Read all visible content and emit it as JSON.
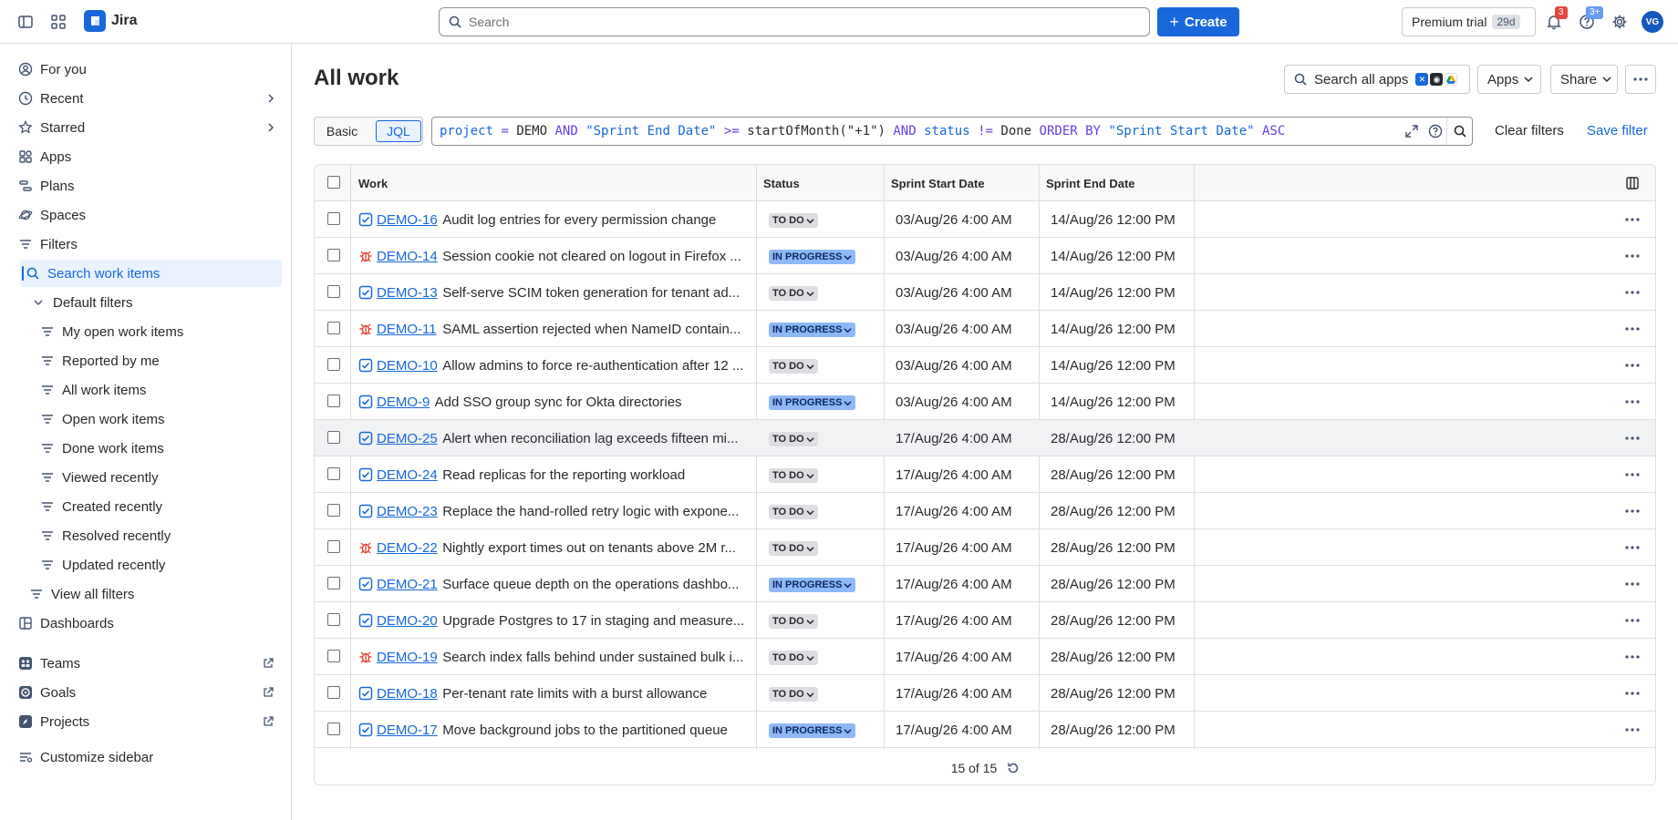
{
  "topbar": {
    "brand": "Jira",
    "search_placeholder": "Search",
    "create_label": "Create",
    "trial_label": "Premium trial",
    "trial_days": "29d",
    "notifications_badge": "3",
    "help_badge": "3+",
    "avatar_initials": "VG"
  },
  "sidebar": {
    "for_you": "For you",
    "recent": "Recent",
    "starred": "Starred",
    "apps": "Apps",
    "plans": "Plans",
    "spaces": "Spaces",
    "filters": "Filters",
    "search_work_items": "Search work items",
    "default_filters": "Default filters",
    "default_filter_items": [
      "My open work items",
      "Reported by me",
      "All work items",
      "Open work items",
      "Done work items",
      "Viewed recently",
      "Created recently",
      "Resolved recently",
      "Updated recently"
    ],
    "view_all_filters": "View all filters",
    "dashboards": "Dashboards",
    "teams": "Teams",
    "goals": "Goals",
    "projects": "Projects",
    "customize": "Customize sidebar"
  },
  "main": {
    "title": "All work",
    "search_all_apps": "Search all apps",
    "apps_button": "Apps",
    "share_button": "Share",
    "mode_basic": "Basic",
    "mode_jql": "JQL",
    "jql": {
      "t1": "project",
      "t2": " = ",
      "t3": "DEMO",
      "t4": " AND ",
      "t5": "\"Sprint End Date\"",
      "t6": " >= ",
      "t7": "startOfMonth(",
      "t8": "\"+1\"",
      "t9": ")",
      "t10": " AND ",
      "t11": "status",
      "t12": " != ",
      "t13": "Done",
      "t14": " ORDER BY ",
      "t15": "\"Sprint Start Date\"",
      "t16": " ASC"
    },
    "clear_filters": "Clear filters",
    "save_filter": "Save filter",
    "columns": {
      "work": "Work",
      "status": "Status",
      "sprint_start": "Sprint Start Date",
      "sprint_end": "Sprint End Date"
    },
    "rows": [
      {
        "type": "task",
        "key": "DEMO-16",
        "summary": "Audit log entries for every permission change",
        "status": "TO DO",
        "start": "03/Aug/26 4:00 AM",
        "end": "14/Aug/26 12:00 PM"
      },
      {
        "type": "bug",
        "key": "DEMO-14",
        "summary": "Session cookie not cleared on logout in Firefox ...",
        "status": "IN PROGRESS",
        "start": "03/Aug/26 4:00 AM",
        "end": "14/Aug/26 12:00 PM"
      },
      {
        "type": "task",
        "key": "DEMO-13",
        "summary": "Self-serve SCIM token generation for tenant ad...",
        "status": "TO DO",
        "start": "03/Aug/26 4:00 AM",
        "end": "14/Aug/26 12:00 PM"
      },
      {
        "type": "bug",
        "key": "DEMO-11",
        "summary": "SAML assertion rejected when NameID contain...",
        "status": "IN PROGRESS",
        "start": "03/Aug/26 4:00 AM",
        "end": "14/Aug/26 12:00 PM"
      },
      {
        "type": "task",
        "key": "DEMO-10",
        "summary": "Allow admins to force re-authentication after 12 ...",
        "status": "TO DO",
        "start": "03/Aug/26 4:00 AM",
        "end": "14/Aug/26 12:00 PM"
      },
      {
        "type": "task",
        "key": "DEMO-9",
        "summary": "Add SSO group sync for Okta directories",
        "status": "IN PROGRESS",
        "start": "03/Aug/26 4:00 AM",
        "end": "14/Aug/26 12:00 PM"
      },
      {
        "type": "task",
        "key": "DEMO-25",
        "summary": "Alert when reconciliation lag exceeds fifteen mi...",
        "status": "TO DO",
        "start": "17/Aug/26 4:00 AM",
        "end": "28/Aug/26 12:00 PM"
      },
      {
        "type": "task",
        "key": "DEMO-24",
        "summary": "Read replicas for the reporting workload",
        "status": "TO DO",
        "start": "17/Aug/26 4:00 AM",
        "end": "28/Aug/26 12:00 PM"
      },
      {
        "type": "task",
        "key": "DEMO-23",
        "summary": "Replace the hand-rolled retry logic with expone...",
        "status": "TO DO",
        "start": "17/Aug/26 4:00 AM",
        "end": "28/Aug/26 12:00 PM"
      },
      {
        "type": "bug",
        "key": "DEMO-22",
        "summary": "Nightly export times out on tenants above 2M r...",
        "status": "TO DO",
        "start": "17/Aug/26 4:00 AM",
        "end": "28/Aug/26 12:00 PM"
      },
      {
        "type": "task",
        "key": "DEMO-21",
        "summary": "Surface queue depth on the operations dashbo...",
        "status": "IN PROGRESS",
        "start": "17/Aug/26 4:00 AM",
        "end": "28/Aug/26 12:00 PM"
      },
      {
        "type": "task",
        "key": "DEMO-20",
        "summary": "Upgrade Postgres to 17 in staging and measure...",
        "status": "TO DO",
        "start": "17/Aug/26 4:00 AM",
        "end": "28/Aug/26 12:00 PM"
      },
      {
        "type": "bug",
        "key": "DEMO-19",
        "summary": "Search index falls behind under sustained bulk i...",
        "status": "TO DO",
        "start": "17/Aug/26 4:00 AM",
        "end": "28/Aug/26 12:00 PM"
      },
      {
        "type": "task",
        "key": "DEMO-18",
        "summary": "Per-tenant rate limits with a burst allowance",
        "status": "TO DO",
        "start": "17/Aug/26 4:00 AM",
        "end": "28/Aug/26 12:00 PM"
      },
      {
        "type": "task",
        "key": "DEMO-17",
        "summary": "Move background jobs to the partitioned queue",
        "status": "IN PROGRESS",
        "start": "17/Aug/26 4:00 AM",
        "end": "28/Aug/26 12:00 PM"
      }
    ],
    "highlighted_row": "DEMO-25",
    "count_label": "15 of 15"
  },
  "colors": {
    "accent": "#1868db",
    "todo_lozenge": "#dddee1",
    "in_progress_lozenge": "#8fb8f6",
    "bug": "#e2483d",
    "task": "#1868db"
  }
}
